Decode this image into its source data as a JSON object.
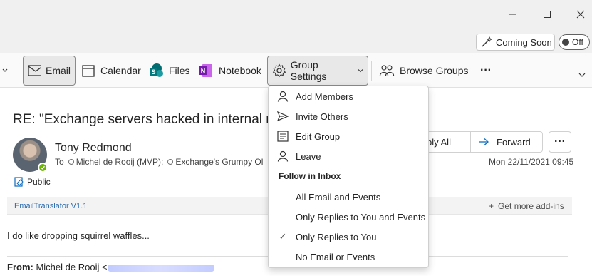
{
  "titlebar": {
    "coming_soon_label": "Coming Soon",
    "toggle_label": "Off"
  },
  "ribbon": {
    "email": "Email",
    "calendar": "Calendar",
    "files": "Files",
    "notebook": "Notebook",
    "group_settings": "Group Settings",
    "browse_groups": "Browse Groups",
    "more": "···"
  },
  "message": {
    "subject": "RE: \"Exchange servers hacked in internal re",
    "sender": "Tony Redmond",
    "to_prefix": "To",
    "recipient1": "Michel de Rooij (MVP);",
    "recipient2": "Exchange's Grumpy Ol",
    "public_label": "Public",
    "reply_all": "ply All",
    "forward": "Forward",
    "more": "···",
    "date": "Mon 22/11/2021 09:45",
    "addin_name": "EmailTranslator V1.1",
    "get_addins": "Get more add-ins",
    "body": "I do like dropping squirrel waffles...",
    "from_label": "From:",
    "from_name": "Michel de Rooij <"
  },
  "menu": {
    "add_members": "Add Members",
    "invite_others": "Invite Others",
    "edit_group": "Edit Group",
    "leave": "Leave",
    "follow_header": "Follow in Inbox",
    "all_email": "All Email and Events",
    "only_replies_events": "Only Replies to You and Events",
    "only_replies": "Only Replies to You",
    "no_email": "No Email or Events",
    "checkmark": "✓"
  },
  "colors": {
    "accent": "#0f6cbd",
    "presence": "#6bb700",
    "onenote": "#7719aa",
    "sharepoint": "#038387"
  }
}
